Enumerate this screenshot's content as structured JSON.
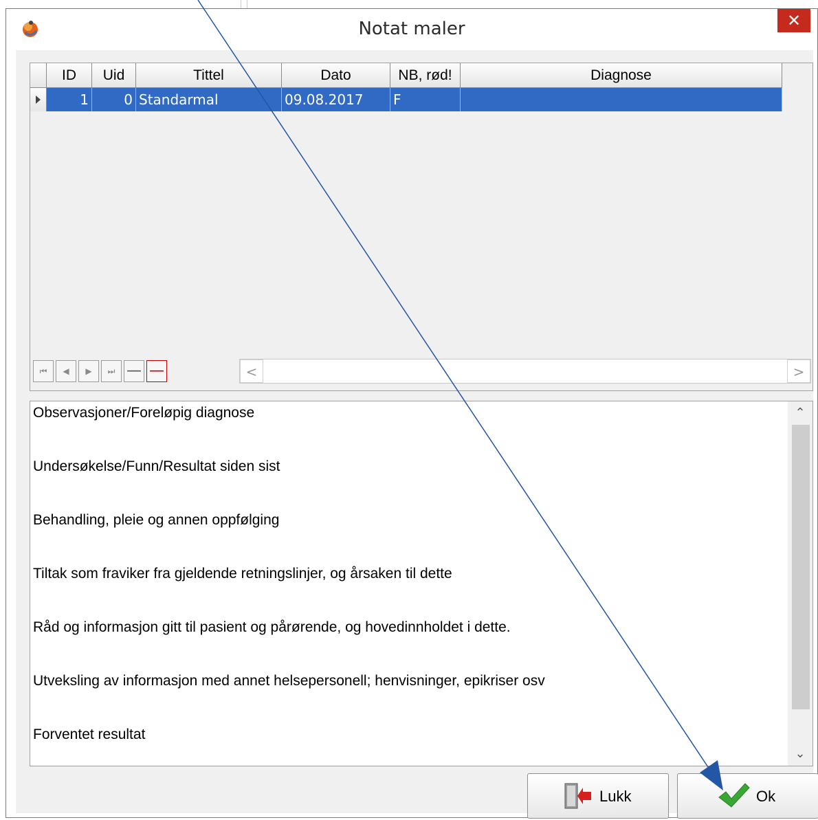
{
  "window": {
    "title": "Notat maler",
    "close_symbol": "✕",
    "app_icon": "app-logo-icon"
  },
  "grid": {
    "columns": [
      "ID",
      "Uid",
      "Tittel",
      "Dato",
      "NB, rød!",
      "Diagnose"
    ],
    "rows": [
      {
        "id": "1",
        "uid": "0",
        "tittel": "Standarmal",
        "dato": "09.08.2017",
        "nb": "F",
        "diagnose": ""
      }
    ],
    "selected_row_color": "#316ac5",
    "navigator": {
      "first": "⏮",
      "prev": "◀",
      "next": "▶",
      "last": "⏭",
      "minus": "—",
      "delete": "—"
    },
    "hscroll": {
      "left": "<",
      "right": ">"
    }
  },
  "memo": {
    "lines": [
      "Observasjoner/Foreløpig diagnose",
      "Undersøkelse/Funn/Resultat siden sist",
      "Behandling, pleie og annen oppfølging",
      "Tiltak som fraviker fra gjeldende retningslinjer, og årsaken til dette",
      "Råd og informasjon gitt til pasient og pårørende, og hovedinnholdet i dette.",
      "Utveksling av informasjon med annet helsepersonell; henvisninger, epikriser osv",
      "Forventet resultat"
    ],
    "scroll_up": "⌃",
    "scroll_down": "⌄"
  },
  "buttons": {
    "close_label": "Lukk",
    "ok_label": "Ok"
  },
  "colors": {
    "accent": "#316ac5",
    "close_button": "#c42b1c",
    "check_green": "#3aa634",
    "annotation_arrow": "#2456a6"
  }
}
